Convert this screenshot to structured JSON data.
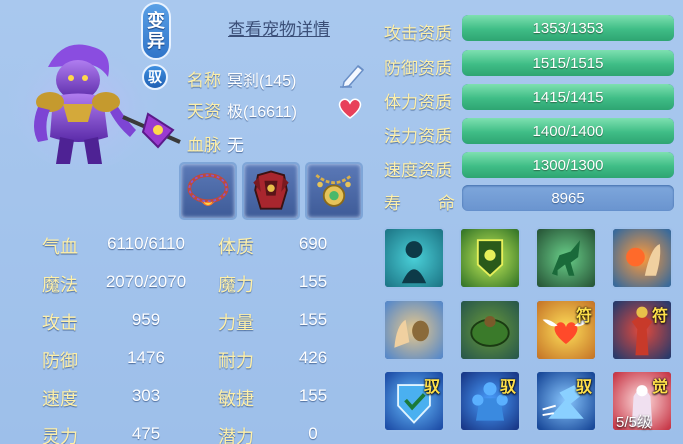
{
  "pet": {
    "mutation_badge": [
      "变",
      "异"
    ],
    "tame_badge": "驭",
    "detail_link": "查看宠物详情",
    "name_label": "名称",
    "name_value": "冥刹(145)",
    "aptitude_label": "天资",
    "aptitude_value": "极(16611)",
    "bloodline_label": "血脉",
    "bloodline_value": "无"
  },
  "equipment": [
    {
      "icon": "necklace-flame-icon"
    },
    {
      "icon": "armor-red-icon"
    },
    {
      "icon": "amulet-gold-icon"
    }
  ],
  "attributes": [
    {
      "label": "攻击资质",
      "value": "1353/1353",
      "fraction": 1.0
    },
    {
      "label": "防御资质",
      "value": "1515/1515",
      "fraction": 1.0
    },
    {
      "label": "体力资质",
      "value": "1415/1415",
      "fraction": 1.0
    },
    {
      "label": "法力资质",
      "value": "1400/1400",
      "fraction": 1.0
    },
    {
      "label": "速度资质",
      "value": "1300/1300",
      "fraction": 1.0
    }
  ],
  "lifespan": {
    "label_a": "寿",
    "label_b": "命",
    "value": "8965"
  },
  "stats": [
    {
      "label": "气血",
      "value": "6110/6110"
    },
    {
      "label": "魔法",
      "value": "2070/2070"
    },
    {
      "label": "攻击",
      "value": "959"
    },
    {
      "label": "防御",
      "value": "1476"
    },
    {
      "label": "速度",
      "value": "303"
    },
    {
      "label": "灵力",
      "value": "475"
    }
  ],
  "stats_right": [
    {
      "label": "体质",
      "value": "690"
    },
    {
      "label": "魔力",
      "value": "155"
    },
    {
      "label": "力量",
      "value": "155"
    },
    {
      "label": "耐力",
      "value": "426"
    },
    {
      "label": "敏捷",
      "value": "155"
    },
    {
      "label": "潜力",
      "value": "0"
    }
  ],
  "skills": [
    {
      "icon": "water-spirit-skill-icon",
      "tag": ""
    },
    {
      "icon": "shield-glow-skill-icon",
      "tag": ""
    },
    {
      "icon": "green-horse-skill-icon",
      "tag": ""
    },
    {
      "icon": "hand-fire-skill-icon",
      "tag": ""
    },
    {
      "icon": "hand-stone-skill-icon",
      "tag": ""
    },
    {
      "icon": "turtle-skill-icon",
      "tag": ""
    },
    {
      "icon": "wing-heart-skill-icon",
      "tag": "符"
    },
    {
      "icon": "fire-figure-skill-icon",
      "tag": "符"
    },
    {
      "icon": "blue-shield-skill-icon",
      "tag": "驭"
    },
    {
      "icon": "muscle-skill-icon",
      "tag": "驭"
    },
    {
      "icon": "runner-skill-icon",
      "tag": "驭"
    },
    {
      "icon": "awaken-skill-icon",
      "tag": "觉"
    }
  ],
  "skill_level": "5/5级"
}
